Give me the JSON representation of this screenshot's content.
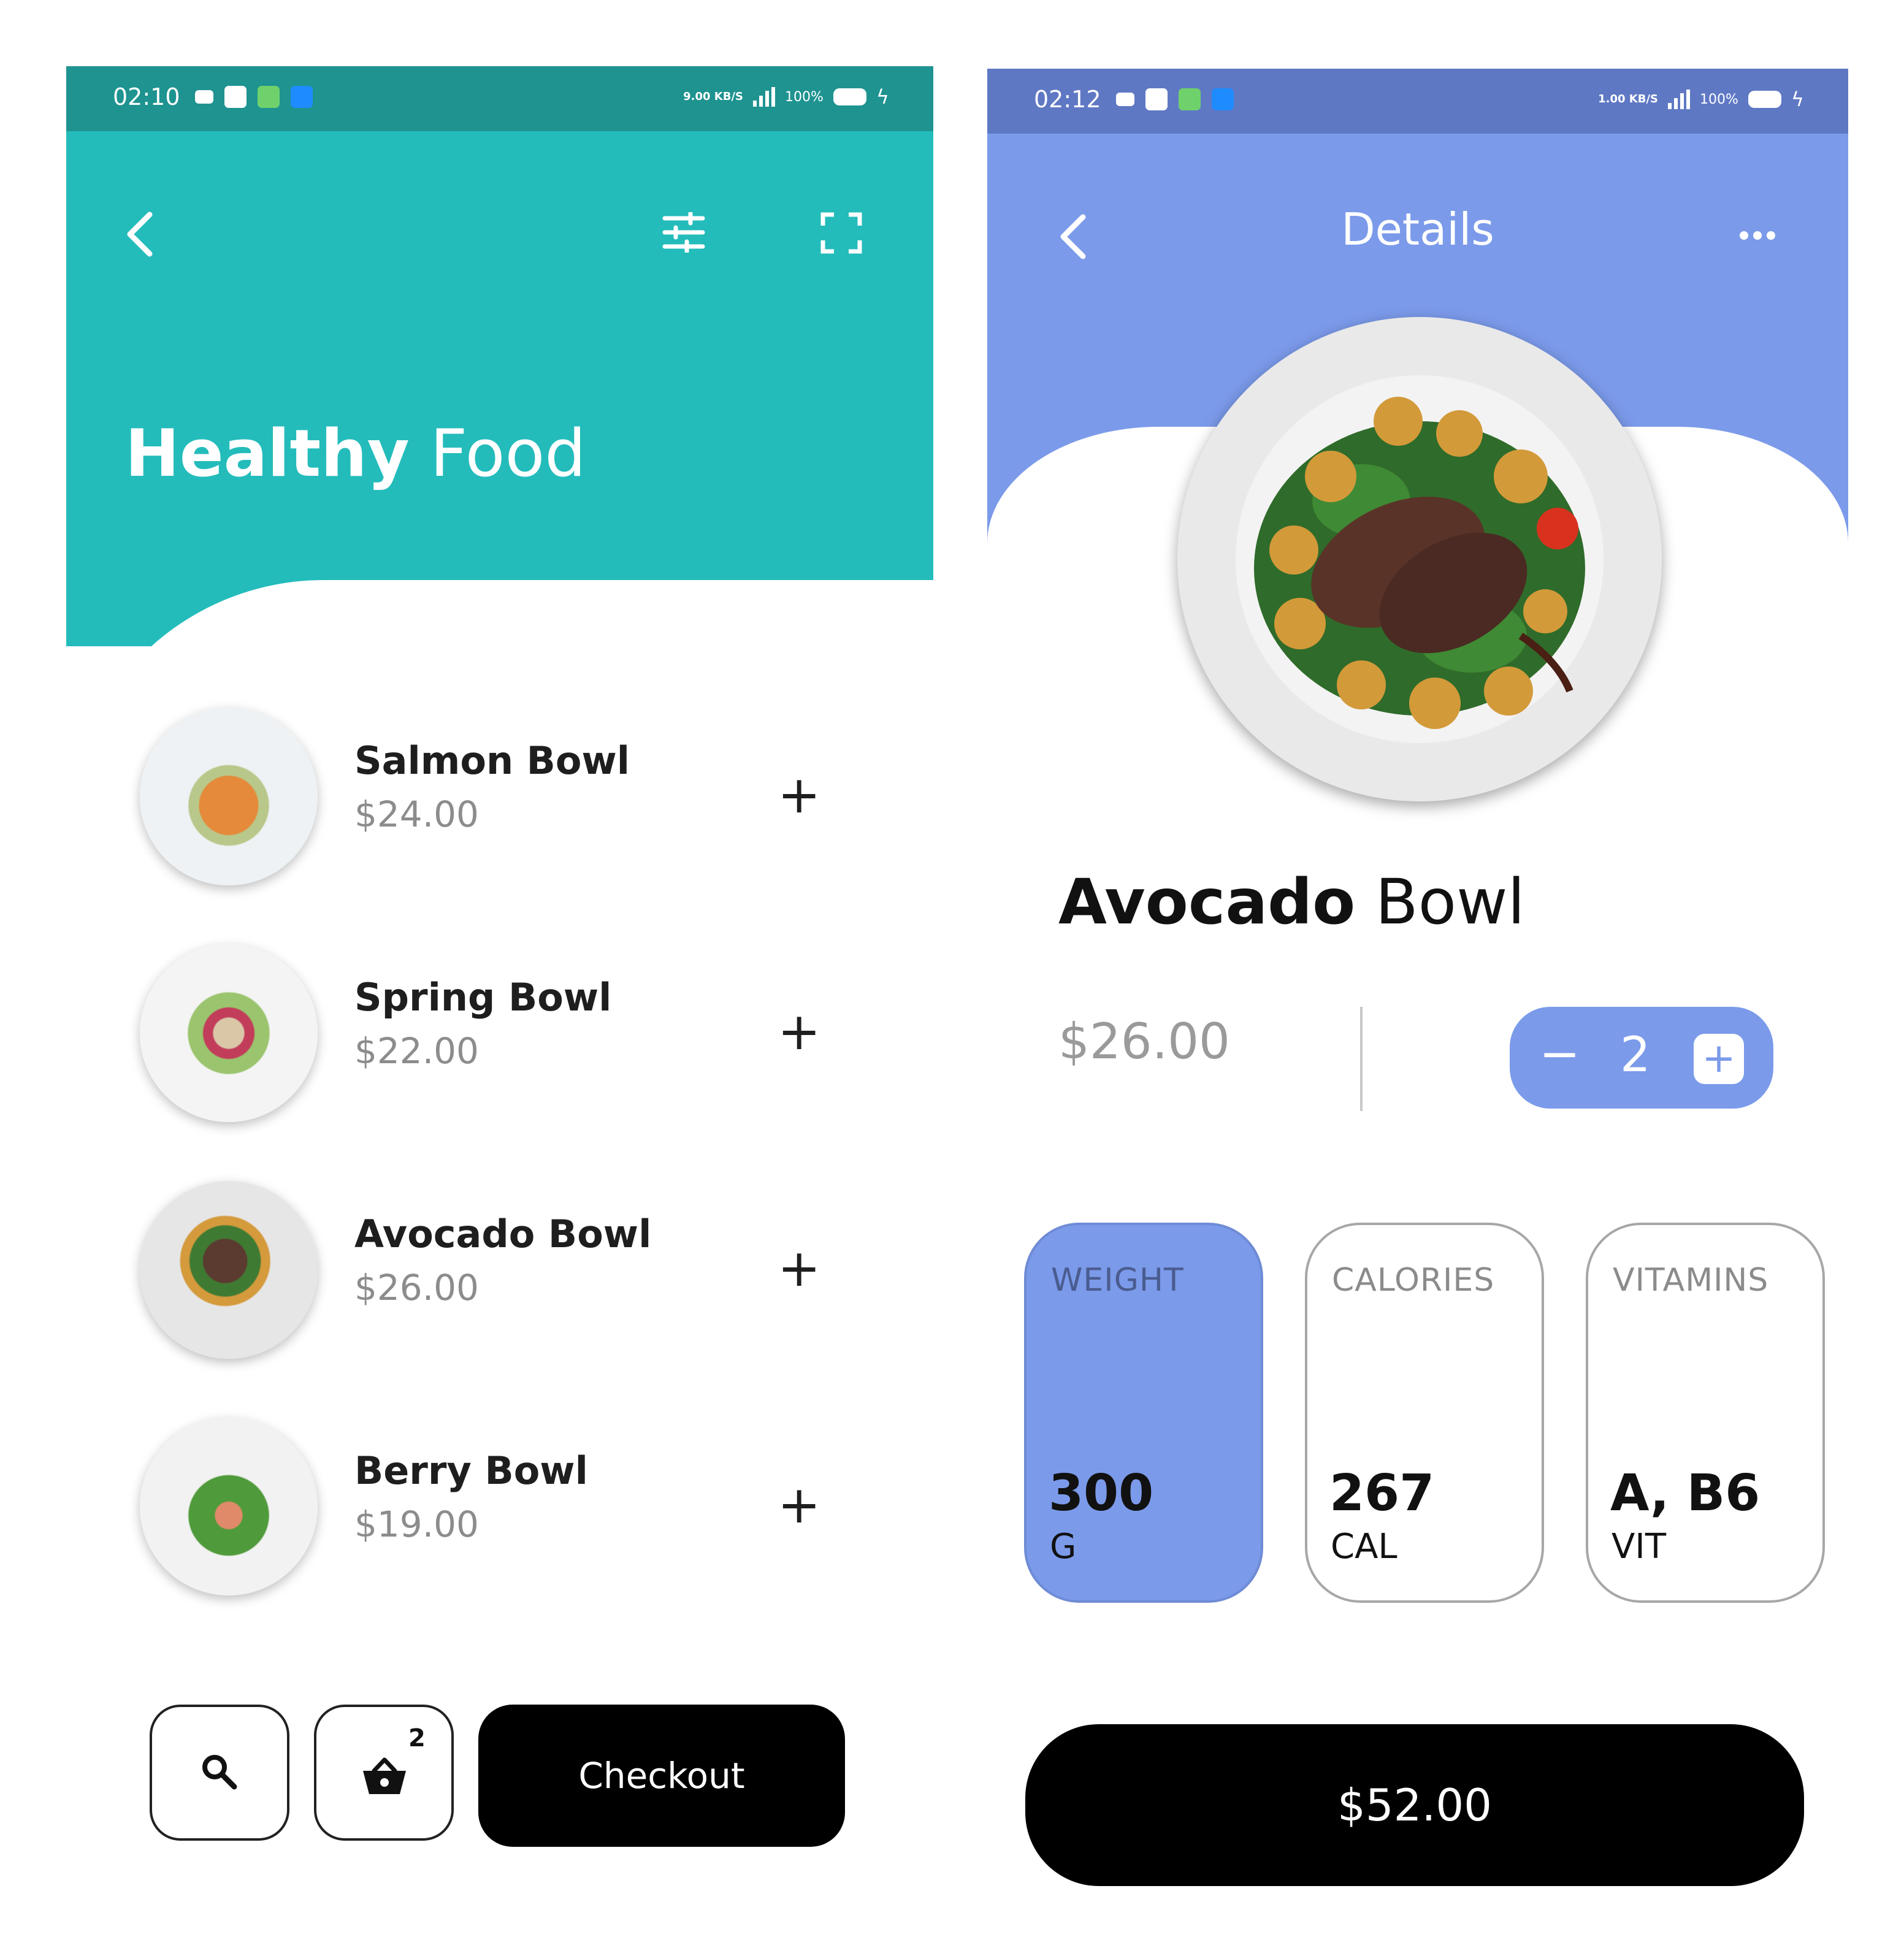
{
  "left_screen": {
    "status_bar": {
      "time": "02:10",
      "net_speed": "9.00 KB/S",
      "battery": "100%"
    },
    "header": {
      "title_bold": "Healthy",
      "title_light": "Food"
    },
    "icons": {
      "back": "chevron-left-icon",
      "filter": "sliders-icon",
      "expand": "fullscreen-icon"
    },
    "items": [
      {
        "name": "Salmon Bowl",
        "price": "$24.00"
      },
      {
        "name": "Spring Bowl",
        "price": "$22.00"
      },
      {
        "name": "Avocado Bowl",
        "price": "$26.00"
      },
      {
        "name": "Berry Bowl",
        "price": "$19.00"
      }
    ],
    "add_symbol": "+",
    "bottom": {
      "cart_count": "2",
      "checkout_label": "Checkout"
    },
    "colors": {
      "header": "#23bcbb",
      "status": "#1e9390"
    }
  },
  "right_screen": {
    "status_bar": {
      "time": "02:12",
      "net_speed": "1.00 KB/S",
      "battery": "100%"
    },
    "header": {
      "title": "Details"
    },
    "product": {
      "name_bold": "Avocado",
      "name_light": "Bowl",
      "price": "$26.00"
    },
    "stepper": {
      "minus": "−",
      "quantity": "2",
      "plus": "+"
    },
    "cards": [
      {
        "label": "WEIGHT",
        "value": "300",
        "unit": "G",
        "active": true
      },
      {
        "label": "CALORIES",
        "value": "267",
        "unit": "CAL",
        "active": false
      },
      {
        "label": "VITAMINS",
        "value": "A, B6",
        "unit": "VIT",
        "active": false
      }
    ],
    "total_button": "$52.00",
    "colors": {
      "header": "#7b9aea",
      "status": "#5f78c4"
    }
  }
}
